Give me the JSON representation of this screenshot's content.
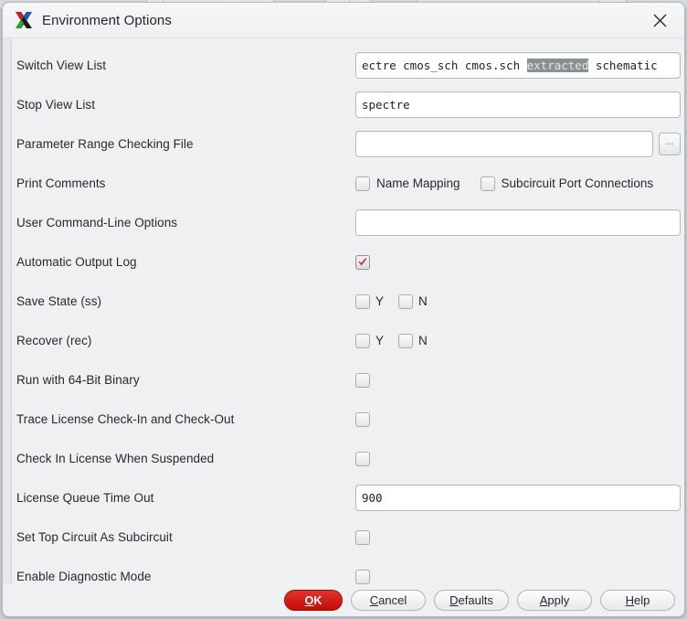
{
  "window": {
    "title": "Environment Options",
    "icon": "x-logo-icon",
    "close_icon": "close-icon"
  },
  "colors": {
    "dialog_bg": "#eff0f1",
    "ok_button_red": "#c30d08",
    "checkmark_red": "#cc1b1b",
    "selection_gray": "#8c8f92",
    "text": "#26292e"
  },
  "rows": {
    "switch_view_list": {
      "label": "Switch View List",
      "value_before": "ectre cmos_sch cmos.sch ",
      "value_selected": "extracted",
      "value_after": " schematic",
      "full_value": "spectre cmos_sch cmos.sch extracted schematic"
    },
    "stop_view_list": {
      "label": "Stop View List",
      "value": "spectre"
    },
    "parameter_range_checking_file": {
      "label": "Parameter Range Checking File",
      "value": "",
      "browse_label": "...",
      "browse_icon": "ellipsis-icon"
    },
    "print_comments": {
      "label": "Print Comments",
      "options": [
        {
          "label": "Name Mapping",
          "checked": false
        },
        {
          "label": "Subcircuit Port Connections",
          "checked": false
        }
      ]
    },
    "user_command_line_options": {
      "label": "User Command-Line Options",
      "value": ""
    },
    "automatic_output_log": {
      "label": "Automatic Output Log",
      "checked": true,
      "check_icon": "checkmark-icon"
    },
    "save_state": {
      "label": "Save State (ss)",
      "options": [
        {
          "label": "Y",
          "checked": false
        },
        {
          "label": "N",
          "checked": false
        }
      ]
    },
    "recover": {
      "label": "Recover (rec)",
      "options": [
        {
          "label": "Y",
          "checked": false
        },
        {
          "label": "N",
          "checked": false
        }
      ]
    },
    "run_with_64bit_binary": {
      "label": "Run with 64-Bit Binary",
      "checked": false
    },
    "trace_license": {
      "label": "Trace License Check-In and Check-Out",
      "checked": false
    },
    "check_in_license_suspended": {
      "label": "Check In License When Suspended",
      "checked": false
    },
    "license_queue_time_out": {
      "label": "License Queue Time Out",
      "value": "900"
    },
    "set_top_circuit_as_subcircuit": {
      "label": "Set Top Circuit As Subcircuit",
      "checked": false
    },
    "enable_diagnostic_mode": {
      "label": "Enable Diagnostic Mode",
      "checked": false
    }
  },
  "footer": {
    "ok": {
      "mnemonic": "O",
      "rest": "K"
    },
    "cancel": {
      "mnemonic": "C",
      "rest": "ancel"
    },
    "defaults": {
      "mnemonic": "D",
      "rest": "efaults"
    },
    "apply": {
      "mnemonic": "A",
      "rest": "pply"
    },
    "help": {
      "mnemonic": "H",
      "rest": "elp"
    }
  }
}
